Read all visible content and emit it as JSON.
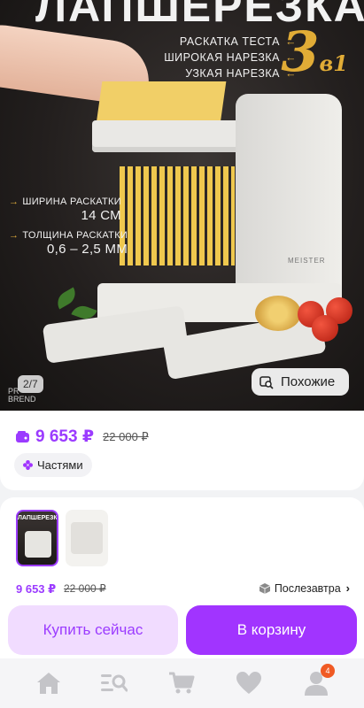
{
  "hero": {
    "title": "ЛАПШЕРЕЗКА",
    "features": [
      {
        "label": "РАСКАТКА ТЕСТА"
      },
      {
        "label": "ШИРОКАЯ НАРЕЗКА"
      },
      {
        "label": "УЗКАЯ НАРЕЗКА"
      }
    ],
    "badge_number": "3",
    "badge_suffix": "в1",
    "spec_width_label": "ШИРИНА РАСКАТКИ",
    "spec_width_value": "14 СМ",
    "spec_thick_label": "ТОЛЩИНА РАСКАТКИ",
    "spec_thick_value": "0,6 – 2,5 ММ",
    "machine_brand": "MEISTER",
    "counter": "2/7",
    "brand_corner": "PR\nBREND",
    "similar_label": "Похожие"
  },
  "price": {
    "current": "9 653 ₽",
    "old": "22 000 ₽",
    "installment_label": "Частями"
  },
  "thumbs": {
    "thumb1_text": "ЛАПШЕРЕЗКА"
  },
  "buy_bar": {
    "price": "9 653 ₽",
    "old_price": "22 000 ₽",
    "delivery": "Послезавтра",
    "buy_now": "Купить сейчас",
    "add_to_cart": "В корзину"
  },
  "nav": {
    "profile_badge": "4"
  },
  "colors": {
    "accent": "#a134ff",
    "accent_light": "#f1dcff",
    "badge": "#f05a24",
    "gold": "#e1ac36"
  },
  "icons": [
    "wallet-icon",
    "parts-icon",
    "search-image-icon",
    "box-icon",
    "chevron-right-icon",
    "home-icon",
    "catalog-search-icon",
    "cart-icon",
    "heart-icon",
    "profile-icon"
  ]
}
